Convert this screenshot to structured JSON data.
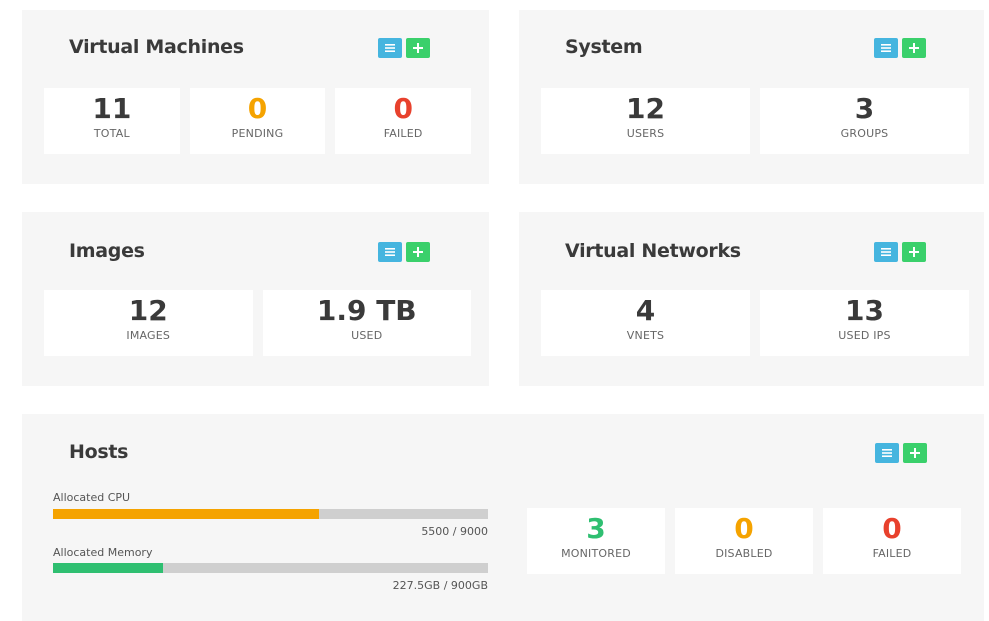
{
  "colors": {
    "list_button": "#45b5df",
    "add_button": "#3ad06b",
    "orange": "#f5a300",
    "red": "#e8412d",
    "green": "#2fbf71"
  },
  "virtual_machines": {
    "title": "Virtual Machines",
    "stats": [
      {
        "value": "11",
        "label": "TOTAL"
      },
      {
        "value": "0",
        "label": "PENDING"
      },
      {
        "value": "0",
        "label": "FAILED"
      }
    ]
  },
  "system": {
    "title": "System",
    "stats": [
      {
        "value": "12",
        "label": "USERS"
      },
      {
        "value": "3",
        "label": "GROUPS"
      }
    ]
  },
  "images": {
    "title": "Images",
    "stats": [
      {
        "value": "12",
        "label": "IMAGES"
      },
      {
        "value": "1.9 TB",
        "label": "USED"
      }
    ]
  },
  "virtual_networks": {
    "title": "Virtual Networks",
    "stats": [
      {
        "value": "4",
        "label": "VNETS"
      },
      {
        "value": "13",
        "label": "USED IPS"
      }
    ]
  },
  "hosts": {
    "title": "Hosts",
    "cpu": {
      "label": "Allocated CPU",
      "value_text": "5500 / 9000",
      "fraction": 0.611
    },
    "memory": {
      "label": "Allocated Memory",
      "value_text": "227.5GB / 900GB",
      "fraction": 0.253
    },
    "stats": [
      {
        "value": "3",
        "label": "MONITORED"
      },
      {
        "value": "0",
        "label": "DISABLED"
      },
      {
        "value": "0",
        "label": "FAILED"
      }
    ]
  },
  "icons": {
    "list": "list-icon",
    "add": "plus-icon"
  }
}
